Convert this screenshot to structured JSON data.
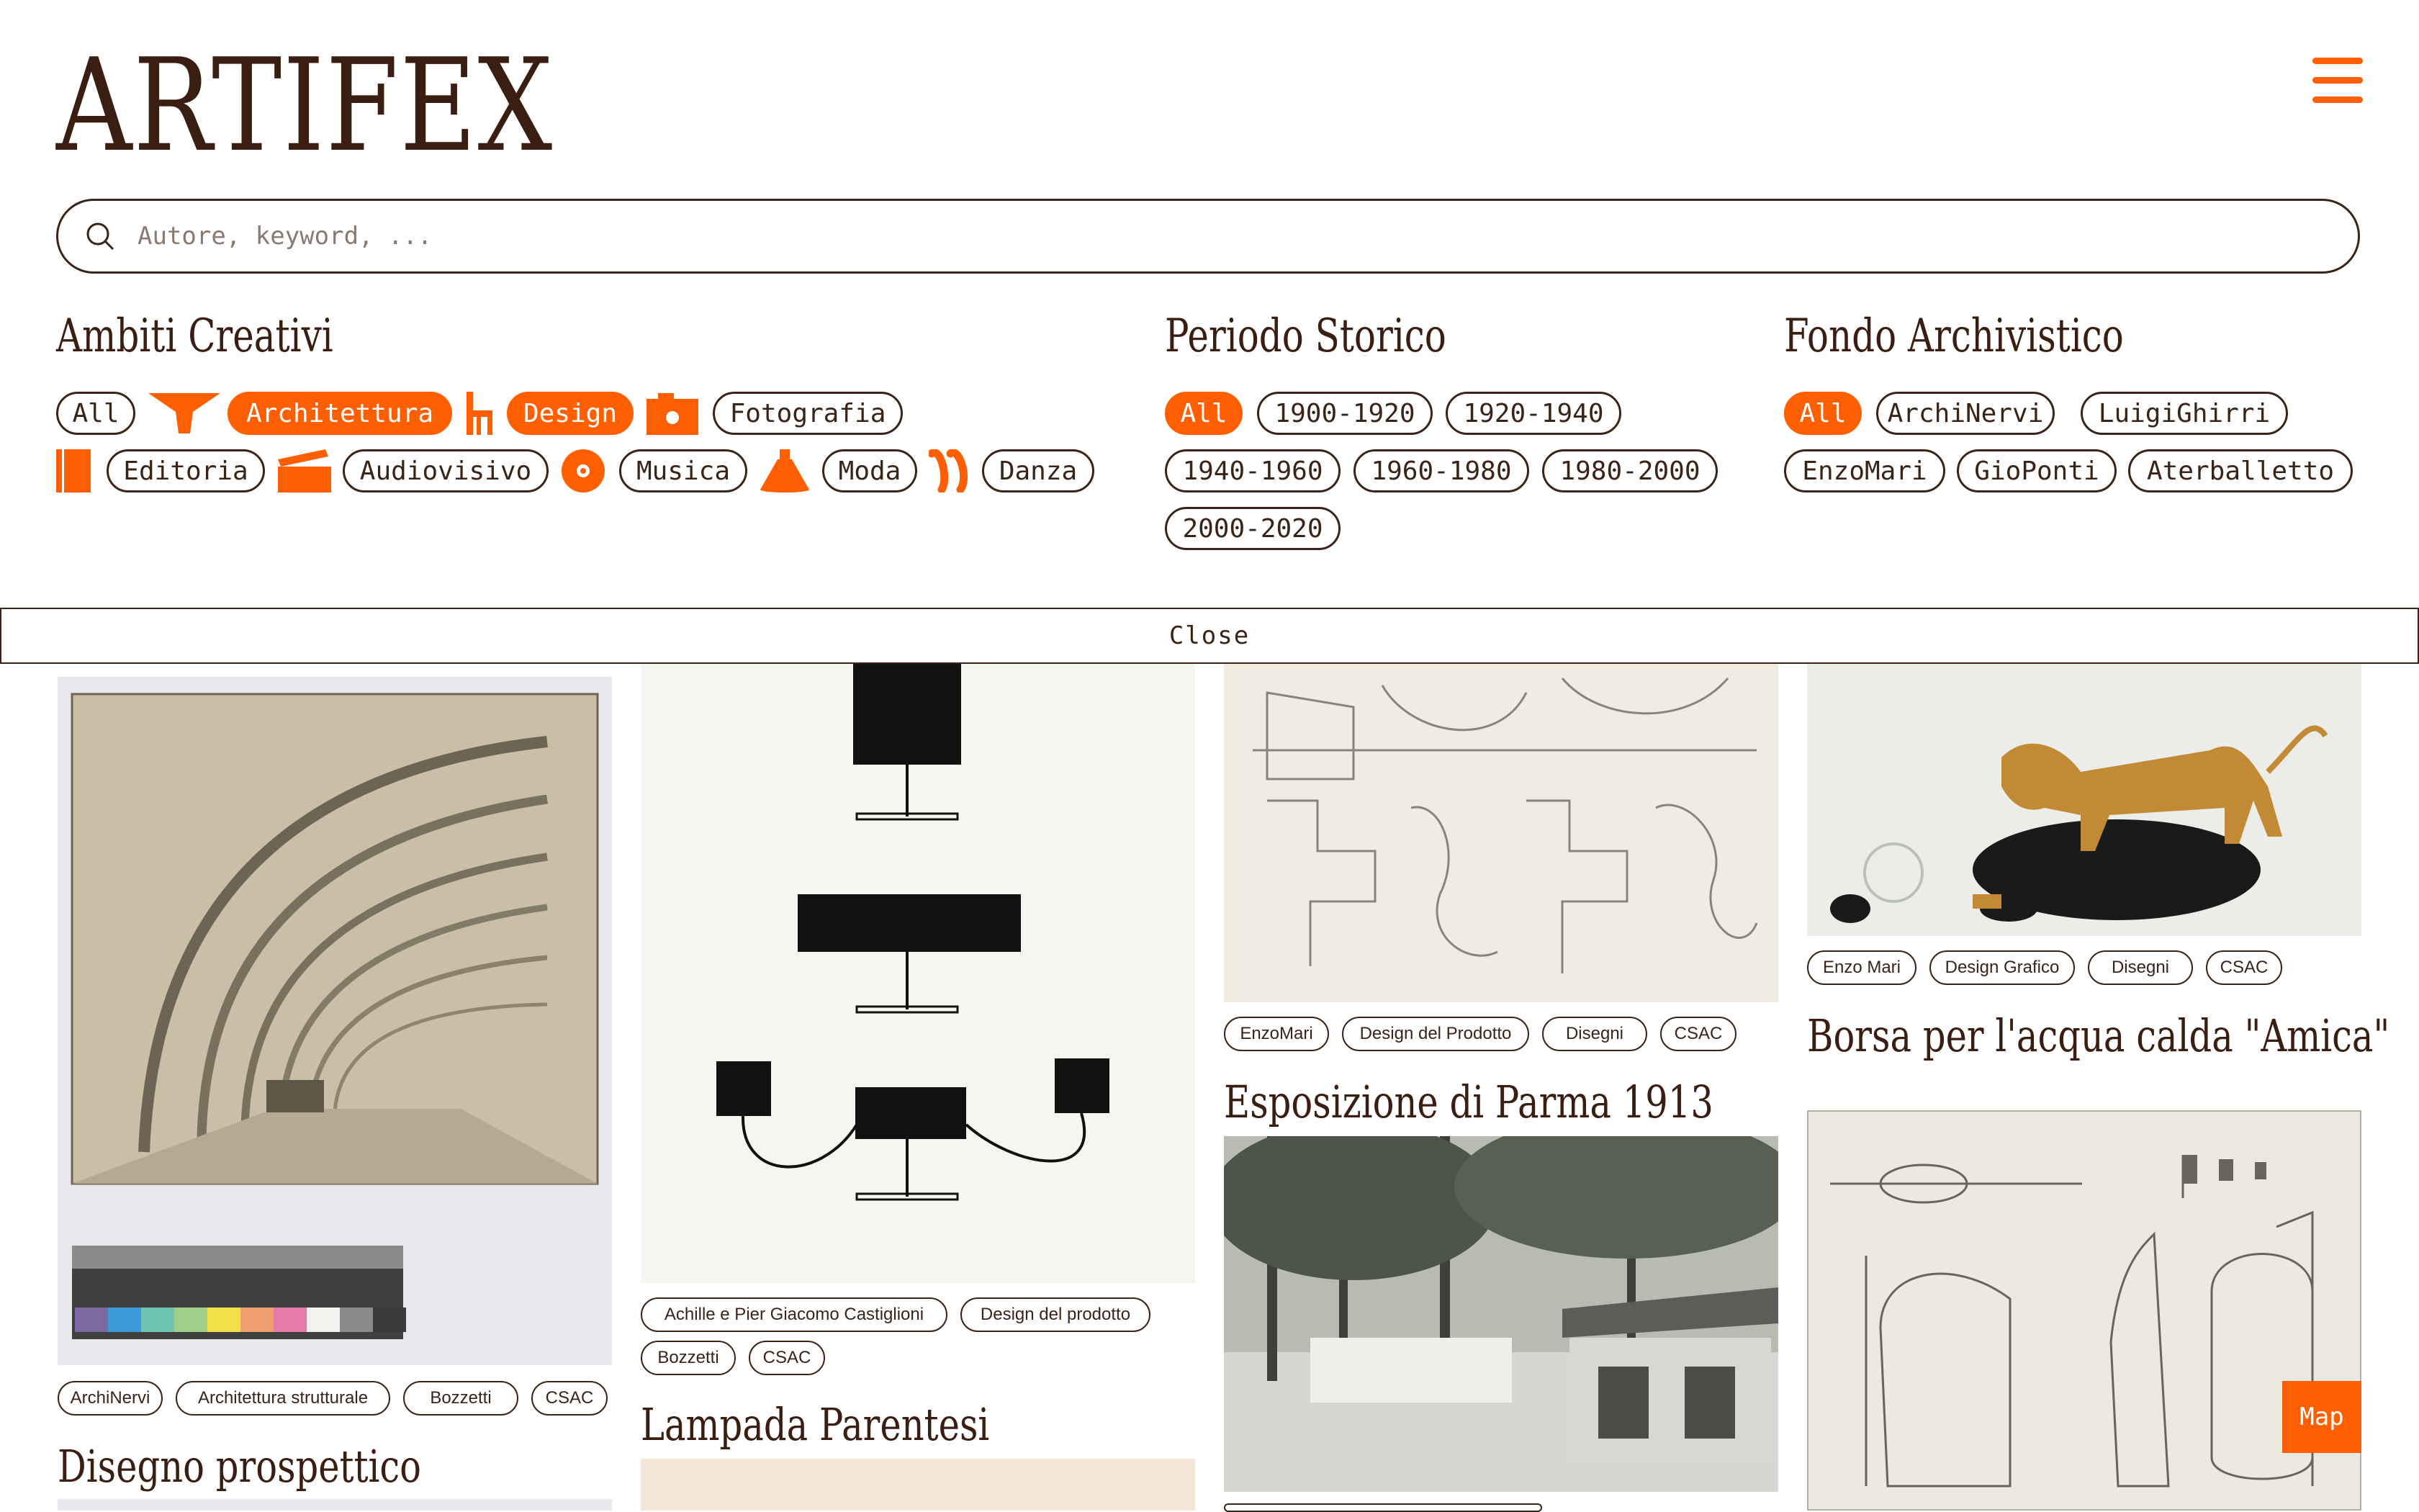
{
  "header": {
    "logo": "ARTIFEX"
  },
  "search": {
    "placeholder": "Autore, keyword, ..."
  },
  "filters": {
    "ambiti": {
      "title": "Ambiti Creativi",
      "items": [
        "All",
        "Architettura",
        "Design",
        "Fotografia",
        "Editoria",
        "Audiovisivo",
        "Musica",
        "Moda",
        "Danza"
      ],
      "selected": [
        "Architettura",
        "Design"
      ]
    },
    "periodo": {
      "title": "Periodo Storico",
      "items": [
        "All",
        "1900-1920",
        "1920-1940",
        "1940-1960",
        "1960-1980",
        "1980-2000",
        "2000-2020"
      ],
      "selected": [
        "All"
      ]
    },
    "fondo": {
      "title": "Fondo Archivistico",
      "items": [
        "All",
        "ArchiNervi",
        "LuigiGhirri",
        "EnzoMari",
        "GioPonti",
        "Aterballetto"
      ],
      "selected": [
        "All"
      ]
    }
  },
  "close_label": "Close",
  "cards": [
    {
      "tags": [
        "ArchiNervi",
        "Architettura strutturale",
        "Bozzetti",
        "CSAC"
      ],
      "next_title": "Disegno prospettico",
      "image": "kodak-color-control-patches"
    },
    {
      "tags": [
        "Achille e Pier Giacomo Castiglioni",
        "Design del prodotto",
        "Bozzetti",
        "CSAC"
      ],
      "next_title": "Lampada Parentesi"
    },
    {
      "tags": [
        "EnzoMari",
        "Design del Prodotto",
        "Disegni",
        "CSAC"
      ],
      "next_title": "Esposizione di Parma 1913"
    },
    {
      "tags": [
        "Enzo Mari",
        "Design Grafico",
        "Disegni",
        "CSAC"
      ],
      "next_title": "Borsa per l'acqua calda \"Amica\""
    }
  ],
  "map_label": "Map",
  "colors": {
    "accent": "#ff5f00",
    "text": "#3a2418"
  }
}
